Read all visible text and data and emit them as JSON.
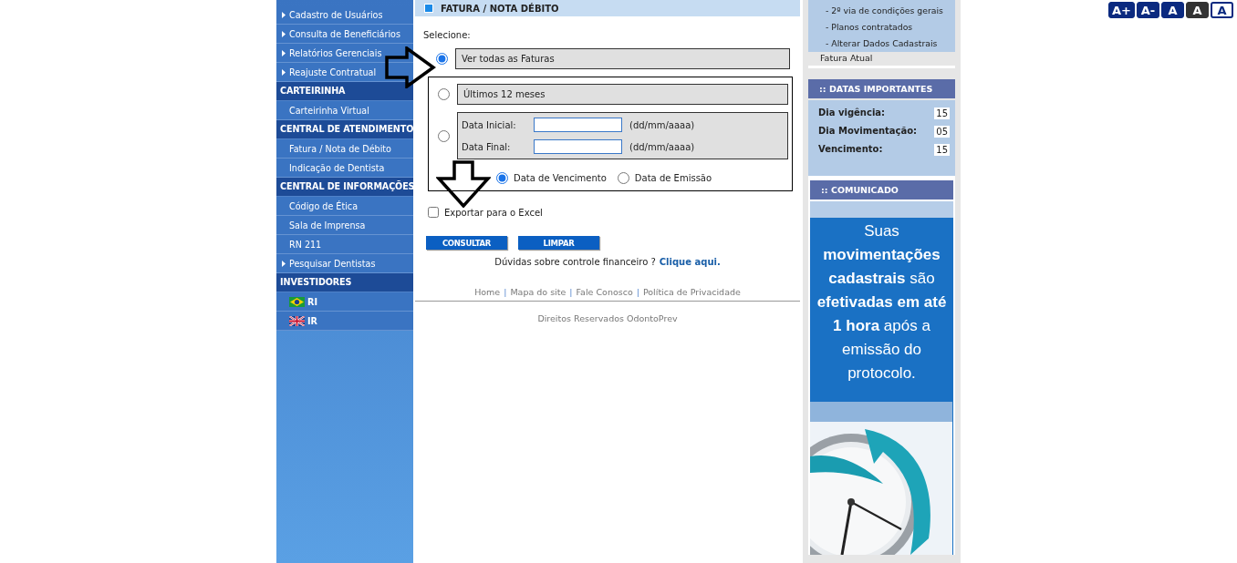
{
  "font_size_buttons": [
    {
      "label": "A+",
      "kind": "blue"
    },
    {
      "label": "A-",
      "kind": "blue"
    },
    {
      "label": "A",
      "kind": "blue"
    },
    {
      "label": "A",
      "kind": "dark"
    },
    {
      "label": "A",
      "kind": "outline"
    }
  ],
  "sidebar": {
    "items": [
      {
        "kind": "link",
        "label": "Cadastro de Usuários",
        "arrow": true
      },
      {
        "kind": "link",
        "label": "Consulta de Beneficiários",
        "arrow": true
      },
      {
        "kind": "link",
        "label": "Relatórios Gerenciais",
        "arrow": true
      },
      {
        "kind": "link",
        "label": "Reajuste Contratual",
        "arrow": true
      },
      {
        "kind": "header",
        "label": "CARTEIRINHA"
      },
      {
        "kind": "link",
        "label": "Carteirinha Virtual",
        "arrow": false
      },
      {
        "kind": "header",
        "label": "CENTRAL DE ATENDIMENTO"
      },
      {
        "kind": "link",
        "label": "Fatura / Nota de Débito",
        "arrow": false
      },
      {
        "kind": "link",
        "label": "Indicação de Dentista",
        "arrow": false
      },
      {
        "kind": "header",
        "label": "CENTRAL DE INFORMAÇÕES"
      },
      {
        "kind": "link",
        "label": "Código de Ética",
        "arrow": false
      },
      {
        "kind": "link",
        "label": "Sala de Imprensa",
        "arrow": false
      },
      {
        "kind": "link",
        "label": "RN 211",
        "arrow": false
      },
      {
        "kind": "link",
        "label": "Pesquisar Dentistas",
        "arrow": true
      },
      {
        "kind": "header",
        "label": "INVESTIDORES"
      },
      {
        "kind": "brazil",
        "label": "RI"
      },
      {
        "kind": "britain",
        "label": "IR"
      }
    ]
  },
  "main": {
    "title": "FATURA / NOTA DÉBITO",
    "prompt": "Selecione:",
    "options": [
      {
        "label": "Ver todas as Faturas",
        "selected": true
      },
      {
        "label": "Últimos 12 meses",
        "selected": false
      },
      {
        "selected": false,
        "fields": [
          {
            "label": "Data Inicial:",
            "hint": "(dd/mm/aaaa)"
          },
          {
            "label": "Data Final:",
            "hint": "(dd/mm/aaaa)"
          }
        ]
      }
    ],
    "date_types": [
      {
        "label": "Data de Vencimento",
        "selected": true
      },
      {
        "label": "Data de Emissão",
        "selected": false
      }
    ],
    "export": {
      "label": "Exportar para o Excel",
      "checked": false
    },
    "buttons": [
      "CONSULTAR",
      "LIMPAR"
    ],
    "help": {
      "text": "Dúvidas sobre controle financeiro ?",
      "link": "Clique aqui."
    },
    "footer_links": [
      "Home",
      "Mapa do site",
      "Fale Conosco",
      "Política de Privacidade"
    ],
    "footer_separator": "|",
    "copyright": "Direitos Reservados OdontoPrev"
  },
  "right": {
    "links": [
      "- 2º via de condições gerais",
      "- Planos contratados",
      "- Alterar Dados Cadastrais"
    ],
    "current": "Fatura Atual",
    "dates": {
      "title": ":: DATAS IMPORTANTES",
      "rows": [
        {
          "label": "Dia vigência:",
          "value": "15"
        },
        {
          "label": "Dia Movimentação:",
          "value": "05"
        },
        {
          "label": "Vencimento:",
          "value": "15"
        }
      ]
    },
    "notice": {
      "title": ":: COMUNICADO",
      "text": "Suas **movimentações cadastrais** são **efetivadas em até 1 hora** após a emissão do protocolo."
    }
  }
}
